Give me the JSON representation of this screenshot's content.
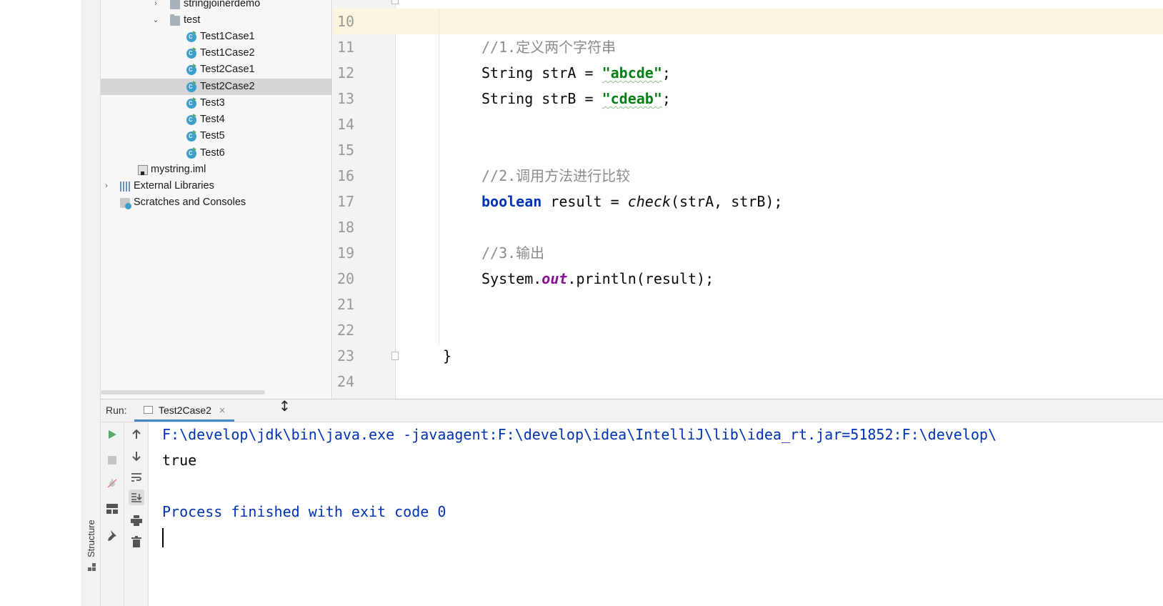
{
  "side_strip": {
    "structure_label": "Structure"
  },
  "project_tree": {
    "items": [
      {
        "label": "stringjoinerdemo",
        "kind": "folder",
        "expander": "›"
      },
      {
        "label": "test",
        "kind": "folder",
        "expander": "⌄"
      },
      {
        "label": "Test1Case1",
        "kind": "class"
      },
      {
        "label": "Test1Case2",
        "kind": "class"
      },
      {
        "label": "Test2Case1",
        "kind": "class"
      },
      {
        "label": "Test2Case2",
        "kind": "class",
        "selected": true
      },
      {
        "label": "Test3",
        "kind": "class"
      },
      {
        "label": "Test4",
        "kind": "class"
      },
      {
        "label": "Test5",
        "kind": "class"
      },
      {
        "label": "Test6",
        "kind": "class"
      },
      {
        "label": "mystring.iml",
        "kind": "file"
      },
      {
        "label": "External Libraries",
        "kind": "libraries",
        "expander": "›"
      },
      {
        "label": "Scratches and Consoles",
        "kind": "scratches"
      }
    ]
  },
  "editor": {
    "line_numbers": [
      "10",
      "11",
      "12",
      "13",
      "14",
      "15",
      "16",
      "17",
      "18",
      "19",
      "20",
      "21",
      "22",
      "23",
      "24"
    ],
    "current_line": "10",
    "code": {
      "comment1": "//1.定义两个字符串",
      "line12_prefix": "String strA = ",
      "line12_string": "\"abcde\"",
      "line12_suffix": ";",
      "line13_prefix": "String strB = ",
      "line13_string": "\"cdeab\"",
      "line13_suffix": ";",
      "comment2": "//2.调用方法进行比较",
      "line17_keyword": "boolean",
      "line17_mid": " result = ",
      "line17_method": "check",
      "line17_args": "(strA, strB);",
      "comment3": "//3.输出",
      "line20_prefix": "System.",
      "line20_field": "out",
      "line20_suffix": ".println(result);",
      "closing_brace": "}"
    }
  },
  "run_panel": {
    "label": "Run:",
    "tab_label": "Test2Case2",
    "tab_close": "×",
    "output_lines": [
      "F:\\develop\\jdk\\bin\\java.exe -javaagent:F:\\develop\\idea\\IntelliJ\\lib\\idea_rt.jar=51852:F:\\develop\\",
      "true",
      "",
      "Process finished with exit code 0"
    ]
  },
  "colors": {
    "keyword": "#0033b3",
    "string": "#067d17",
    "comment": "#8c8c8c",
    "field": "#871094",
    "console_process": "#0033b3",
    "accent": "#4083c9",
    "run_green": "#59a869"
  }
}
